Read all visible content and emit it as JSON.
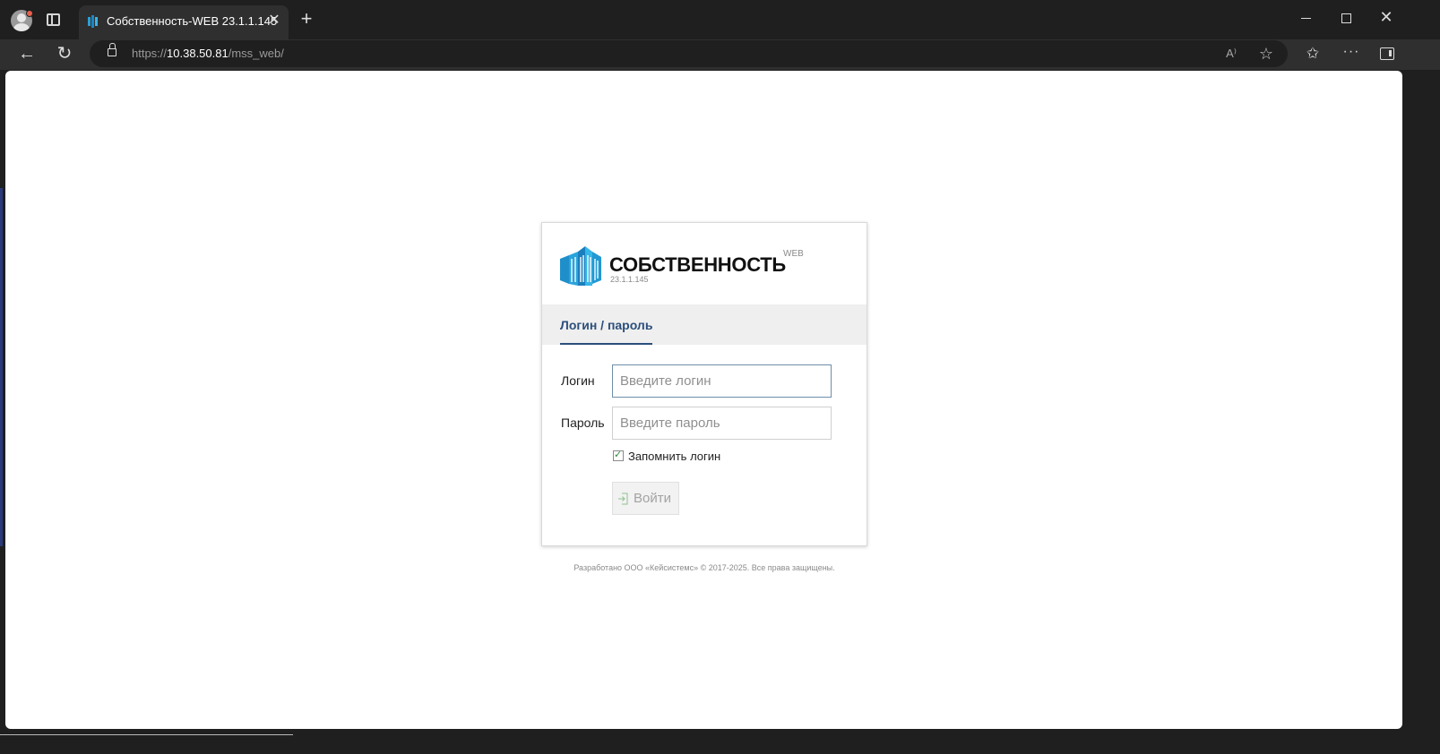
{
  "browser": {
    "tab_title": "Собственность-WEB 23.1.1.145",
    "tab_close": "✕",
    "new_tab": "+",
    "url_scheme": "https://",
    "url_host": "10.38.50.81",
    "url_path": "/mss_web/",
    "read_aloud": "A⁾",
    "favorite_star": "☆",
    "more_menu": "···",
    "close_window": "✕"
  },
  "app": {
    "brand_name": "СОБСТВЕННОСТЬ",
    "brand_suffix": "WEB",
    "version": "23.1.1.145",
    "auth_tab": "Логин / пароль",
    "login_label": "Логин",
    "login_placeholder": "Введите логин",
    "login_value": "",
    "password_label": "Пароль",
    "password_placeholder": "Введите пароль",
    "password_value": "",
    "remember_label": "Запомнить логин",
    "remember_checked": true,
    "submit_label": "Войти",
    "footer": "Разработано ООО «Кейсистемс» © 2017-2025. Все права защищены."
  },
  "colors": {
    "brand_blue": "#2a9fd6",
    "tab_accent": "#2c4f7c",
    "chrome_bg": "#1f1f1f"
  }
}
